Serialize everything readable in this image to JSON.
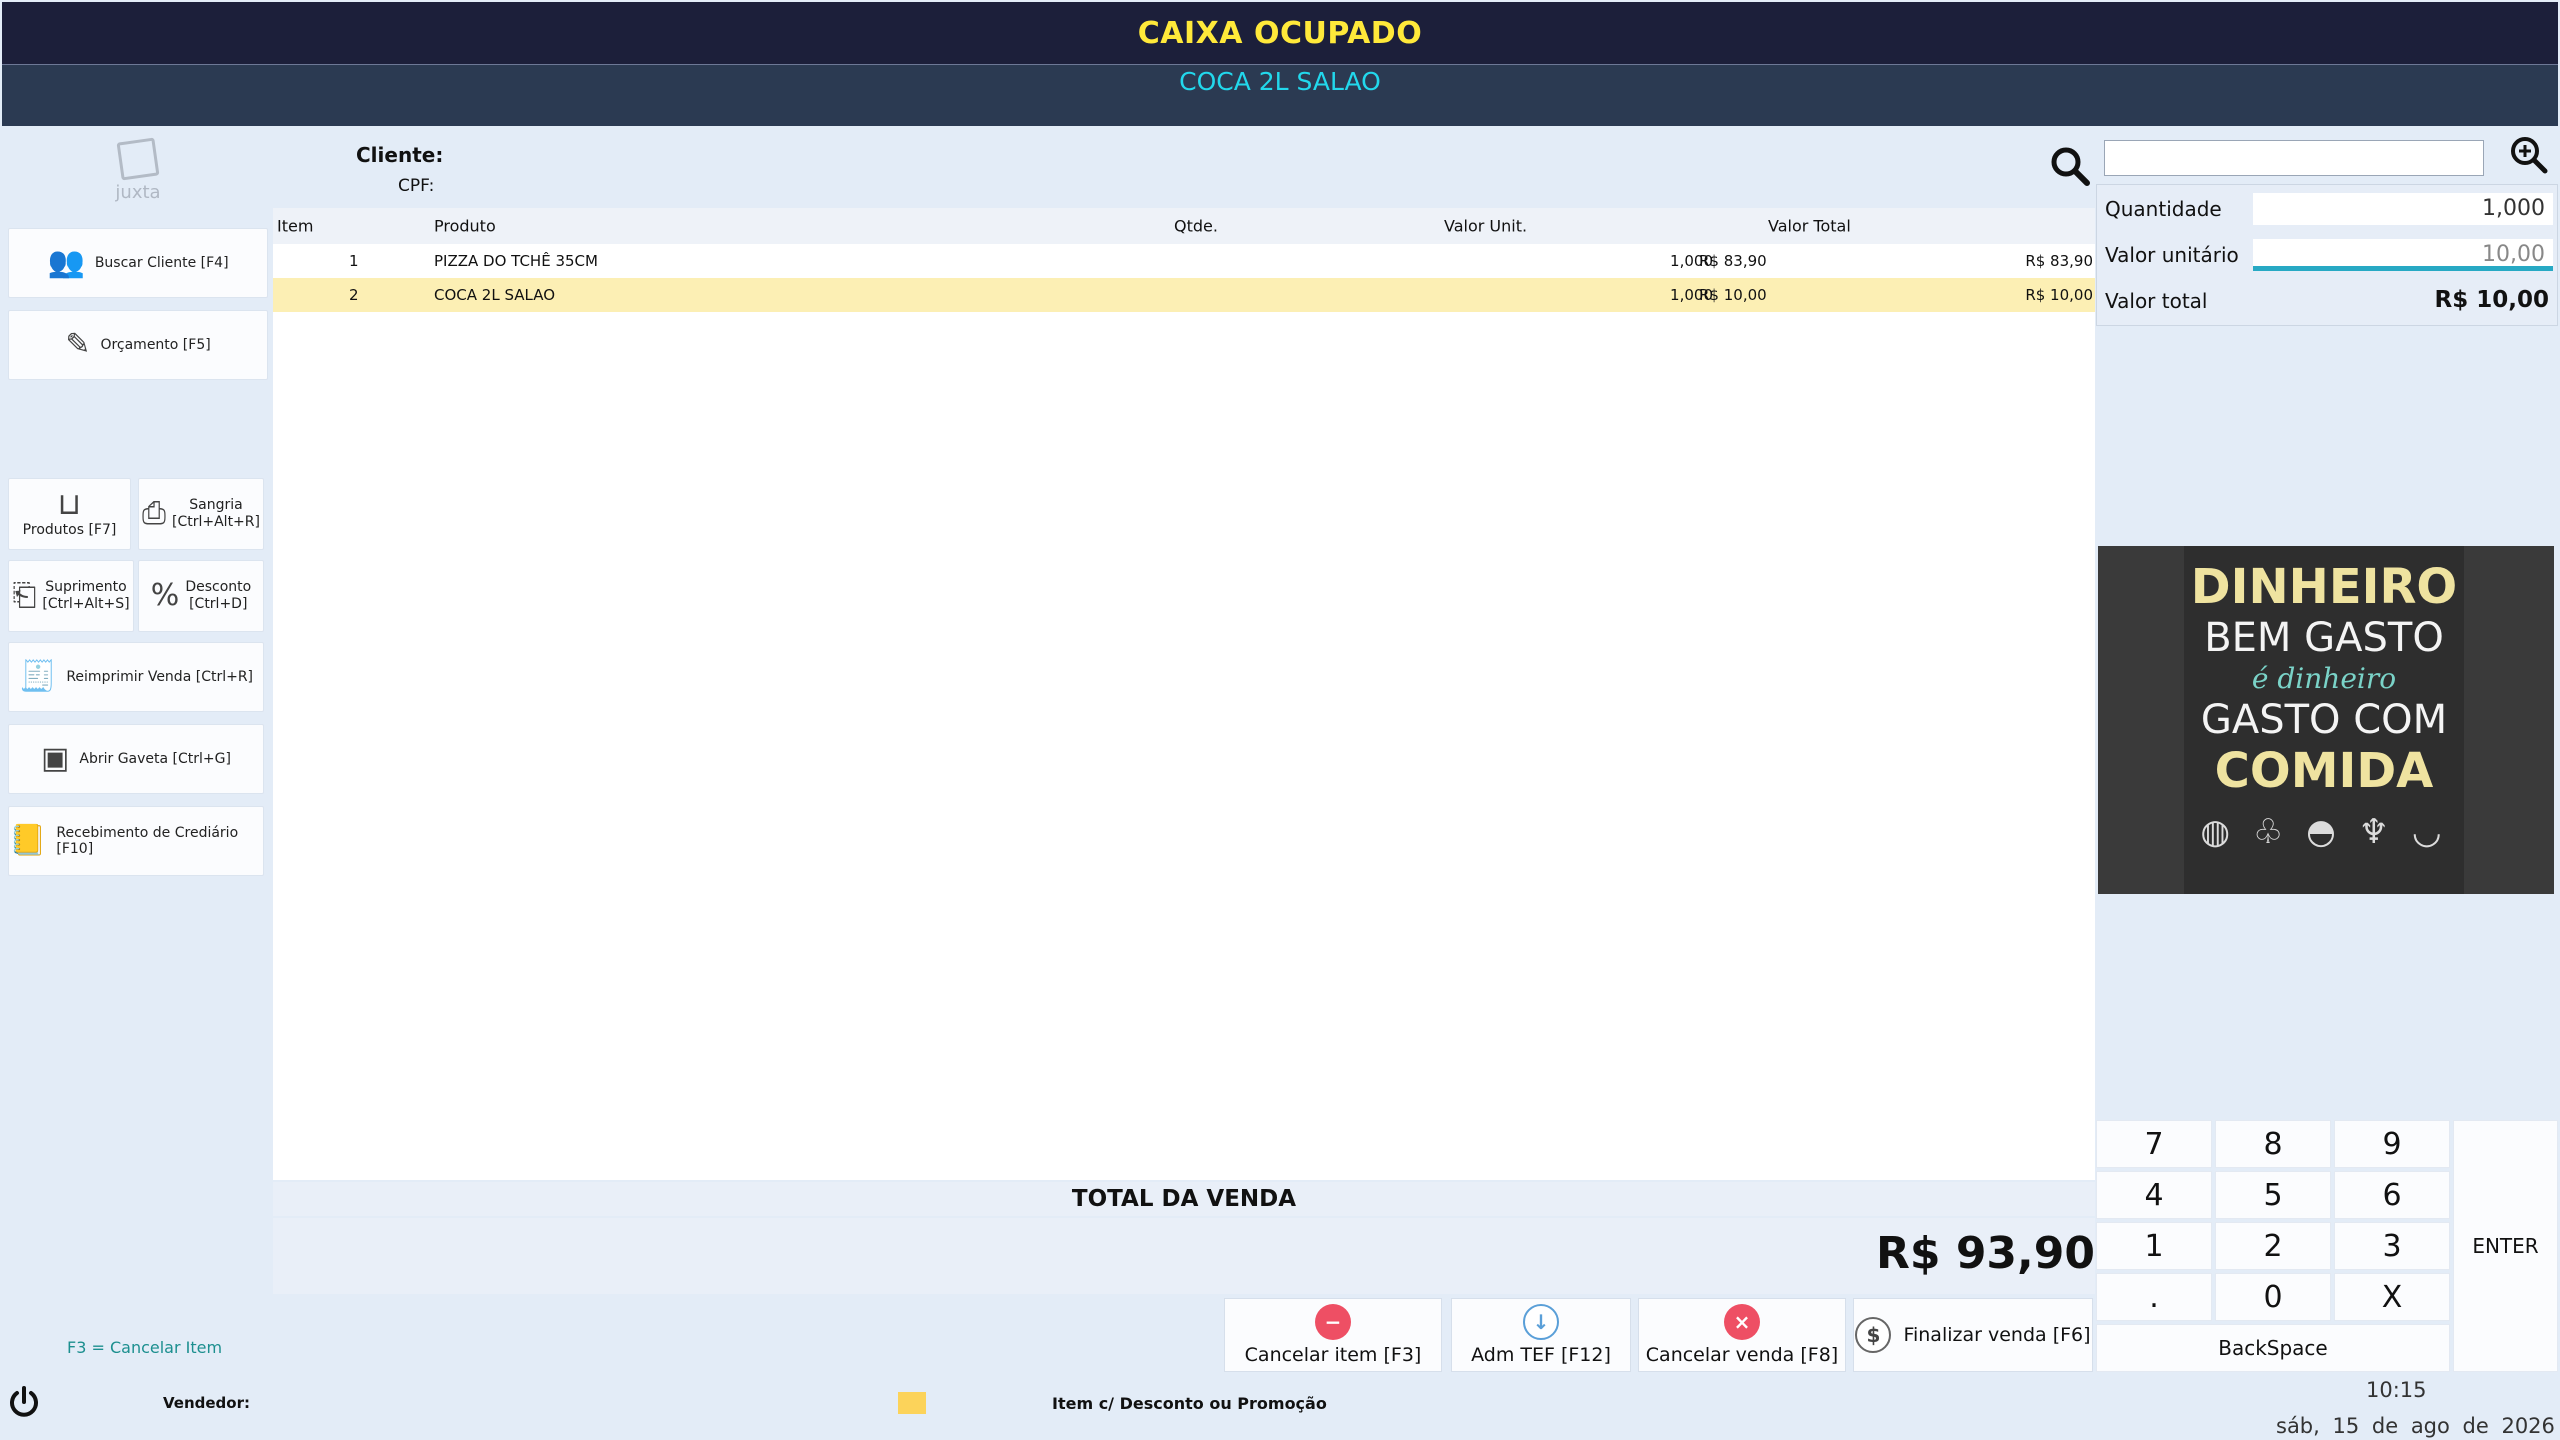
{
  "header": {
    "status": "CAIXA OCUPADO",
    "current_product": "COCA 2L SALAO"
  },
  "logo": {
    "text": "juxta"
  },
  "left_buttons": {
    "buscar_cliente": "Buscar Cliente [F4]",
    "orcamento": "Orçamento [F5]",
    "produtos": "Produtos [F7]",
    "sangria_1": "Sangria",
    "sangria_2": "[Ctrl+Alt+R]",
    "suprimento_1": "Suprimento",
    "suprimento_2": "[Ctrl+Alt+S]",
    "desconto_1": "Desconto",
    "desconto_2": "[Ctrl+D]",
    "reimprimir": "Reimprimir Venda [Ctrl+R]",
    "abrir_gaveta": "Abrir Gaveta [Ctrl+G]",
    "recebimento": "Recebimento de Crediário [F10]"
  },
  "customer": {
    "label": "Cliente:",
    "cpf_label": "CPF:"
  },
  "table": {
    "columns": [
      "Item",
      "Produto",
      "Qtde.",
      "Valor Unit.",
      "Valor Total"
    ],
    "rows": [
      {
        "item": "1",
        "produto": "PIZZA DO TCHÊ 35CM",
        "qtde": "1,000",
        "valor_unit": "R$ 83,90",
        "valor_total": "R$ 83,90"
      },
      {
        "item": "2",
        "produto": "COCA 2L SALAO",
        "qtde": "1,000",
        "valor_unit": "R$ 10,00",
        "valor_total": "R$ 10,00"
      }
    ]
  },
  "totals": {
    "label": "TOTAL DA VENDA",
    "value": "R$ 93,90"
  },
  "bottom_buttons": {
    "cancelar_item": "Cancelar item [F3]",
    "adm_tef": "Adm TEF [F12]",
    "cancelar_venda": "Cancelar venda [F8]",
    "finalizar": "Finalizar venda [F6]"
  },
  "right_panel": {
    "search_value": "",
    "quantidade_label": "Quantidade",
    "quantidade_value": "1,000",
    "valor_unitario_label": "Valor unitário",
    "valor_unitario_value": "10,00",
    "valor_total_label": "Valor total",
    "valor_total_value": "R$ 10,00"
  },
  "promo": {
    "line1": "DINHEIRO",
    "line2": "BEM GASTO",
    "line3": "é dinheiro",
    "line4": "GASTO COM",
    "line5": "COMIDA"
  },
  "keypad": {
    "k7": "7",
    "k8": "8",
    "k9": "9",
    "k4": "4",
    "k5": "5",
    "k6": "6",
    "k1": "1",
    "k2": "2",
    "k3": "3",
    "kdot": ".",
    "k0": "0",
    "kx": "X",
    "enter": "ENTER",
    "backspace": "BackSpace"
  },
  "footer": {
    "hint": "F3 = Cancelar Item",
    "vendedor": "Vendedor:",
    "legend": "Item c/ Desconto ou Promoção",
    "time": "10:15",
    "date": "sáb, 15 de ago de 2026"
  },
  "colors": {
    "header_bg": "#1c1f3a",
    "status_text": "#ffe93a",
    "product_text": "#22d8ec",
    "selected_row": "#fcefb4",
    "legend_color": "#fcd35a"
  }
}
